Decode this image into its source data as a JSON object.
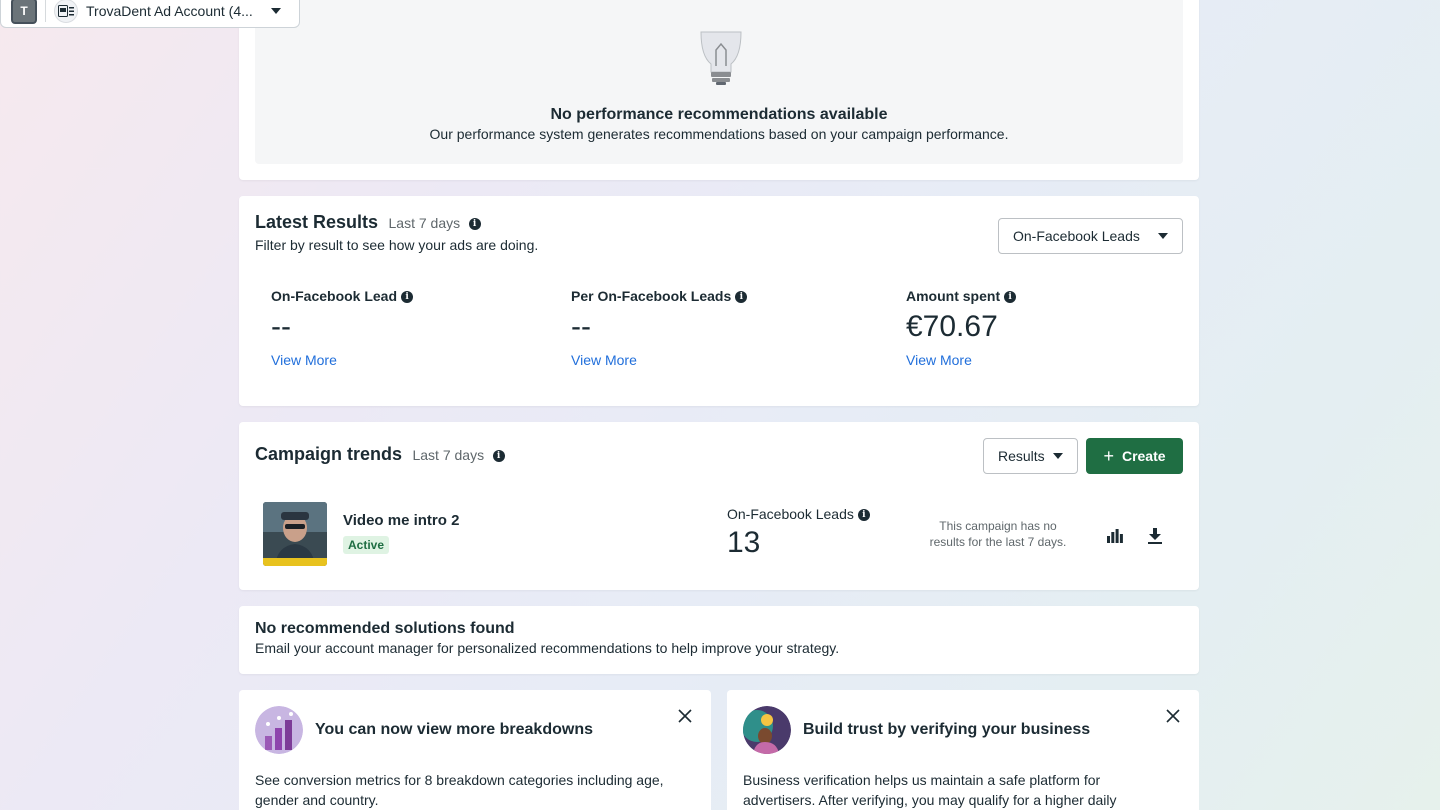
{
  "account_bar": {
    "avatar_letter": "T",
    "account_name": "TrovaDent Ad Account (4..."
  },
  "recommendations": {
    "title": "No performance recommendations available",
    "subtitle": "Our performance system generates recommendations based on your campaign performance."
  },
  "latest_results": {
    "title": "Latest Results",
    "period": "Last 7 days",
    "description": "Filter by result to see how your ads are doing.",
    "filter_value": "On-Facebook Leads",
    "metrics": [
      {
        "label": "On-Facebook Lead",
        "value": "--",
        "link": "View More"
      },
      {
        "label": "Per On-Facebook Leads",
        "value": "--",
        "link": "View More"
      },
      {
        "label": "Amount spent",
        "value": "€70.67",
        "link": "View More"
      }
    ]
  },
  "campaign_trends": {
    "title": "Campaign trends",
    "period": "Last 7 days",
    "results_dropdown": "Results",
    "create_label": "Create",
    "campaign": {
      "name": "Video me intro 2",
      "status": "Active",
      "metric_label": "On-Facebook Leads",
      "metric_value": "13",
      "no_results_text": "This campaign has no results for the last 7 days."
    }
  },
  "solutions": {
    "title": "No recommended solutions found",
    "subtitle": "Email your account manager for personalized recommendations to help improve your strategy."
  },
  "promos": [
    {
      "title": "You can now view more breakdowns",
      "body": "See conversion metrics for 8 breakdown categories including age, gender and country."
    },
    {
      "title": "Build trust by verifying your business",
      "body": "Business verification helps us maintain a safe platform for advertisers. After verifying, you may qualify for a higher daily"
    }
  ],
  "colors": {
    "primary_green": "#1f6e43",
    "link_blue": "#216fdb",
    "active_badge_bg": "#dff3e3"
  }
}
